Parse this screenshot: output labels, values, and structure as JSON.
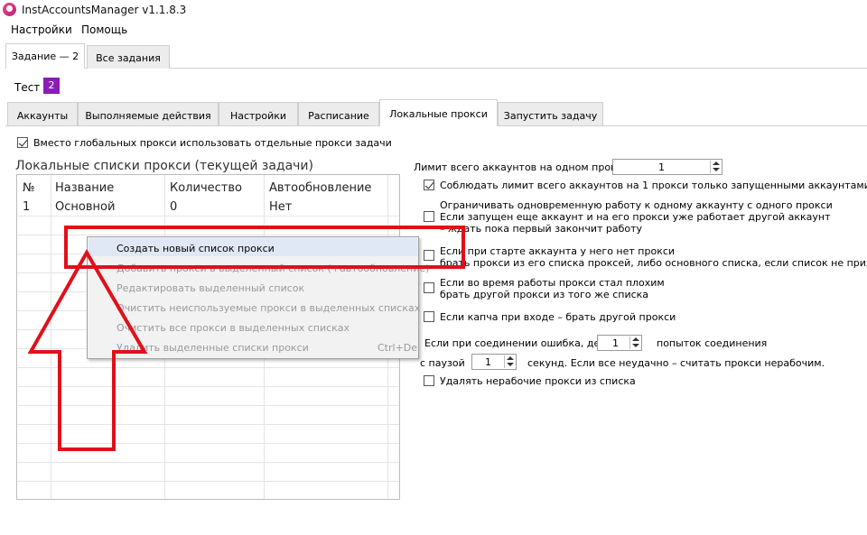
{
  "window": {
    "title": "InstAccountsManager v1.1.8.3"
  },
  "menu": [
    "Настройки",
    "Помощь"
  ],
  "task_tabs": [
    "Задание — 2",
    "Все задания"
  ],
  "task": {
    "name": "Тест",
    "badge": "2"
  },
  "inner_tabs": [
    "Аккаунты",
    "Выполняемые действия",
    "Настройки",
    "Расписание",
    "Локальные прокси",
    "Запустить задачу"
  ],
  "use_local_proxy": {
    "label": "Вместо глобальных прокси использовать отдельные прокси задачи",
    "checked": true
  },
  "proxy_lists": {
    "title": "Локальные списки прокси (текущей задачи)",
    "columns": [
      "№",
      "Название",
      "Количество",
      "Автообновление"
    ],
    "rows": [
      {
        "num": "1",
        "name": "Основной",
        "count": "0",
        "auto": "Нет"
      }
    ]
  },
  "context_menu": {
    "items": [
      "Создать новый список прокси",
      "Добавить прокси в выделенный список (+автообновление)",
      "Редактировать выделенный список",
      "Очистить неиспользуемые прокси в выделенных списках",
      "Очистить все прокси в выделенных списках",
      "Удалить выделенные списки прокси"
    ],
    "shortcut": "Ctrl+Del"
  },
  "settings": {
    "limit_label": "Лимит всего аккаунтов на одном прокси",
    "limit_value": "1",
    "respect_limit": "Соблюдать лимит всего аккаунтов на 1 прокси только запущенными аккаунтами",
    "restrict_line1": "Ограничивать одновременную работу к одному аккаунту с одного прокси",
    "restrict_line2": "Если запущен еще аккаунт и на его прокси уже работает другой аккаунт",
    "restrict_line3": "– ждать пока первый закончит работу",
    "no_proxy_line1": "Если при старте аккаунта у него нет прокси",
    "no_proxy_line2": "брать прокси из его списка проксей, либо основного списка, если список не призначен",
    "bad_line1": "Если во время работы прокси стал плохим",
    "bad_line2": "брать другой прокси из того же списка",
    "captcha": "Если капча при входе – брать другой прокси",
    "conn_error_prefix": "Если при соединении ошибка, делать",
    "conn_attempts": "1",
    "conn_error_suffix": "попыток соединения",
    "pause_prefix": "с паузой",
    "pause_value": "1",
    "pause_suffix": "секунд. Если все неудачно – считать прокси нерабочим.",
    "delete_bad": "Удалять нерабочие прокси из списка"
  },
  "colors": {
    "badge": "#8a1db5",
    "annotation": "#e0101a"
  }
}
